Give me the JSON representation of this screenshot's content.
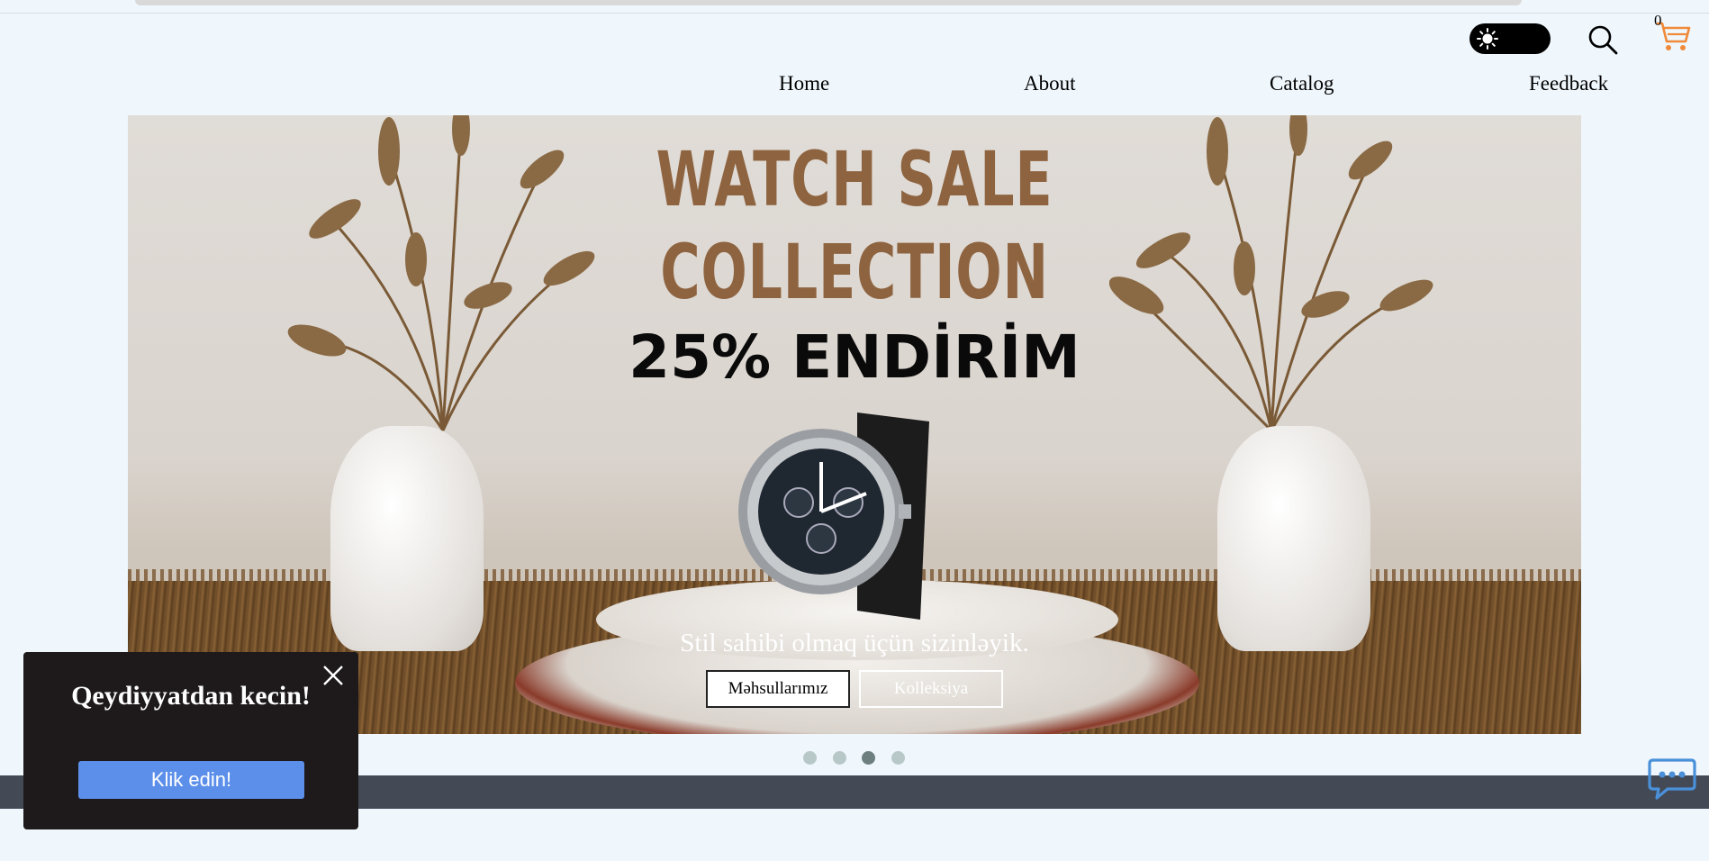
{
  "header": {
    "theme_toggle_icon": "sun-icon",
    "search_icon": "search-icon",
    "cart_icon": "cart-icon",
    "cart_count": "0",
    "cart_color": "#f08a3a"
  },
  "nav": {
    "items": [
      {
        "label": "Home"
      },
      {
        "label": "About"
      },
      {
        "label": "Catalog"
      },
      {
        "label": "Feedback"
      }
    ]
  },
  "hero": {
    "title_line1": "WATCH SALE",
    "title_line2": "COLLECTION",
    "discount": "25% ENDİRİM",
    "tagline": "Stil sahibi olmaq üçün sizinləyik.",
    "primary_button": "Məhsullarımız",
    "secondary_button": "Kolleksiya",
    "title_color": "#8e6440"
  },
  "slider": {
    "dot_count": 4,
    "active_index": 2
  },
  "popup": {
    "title": "Qeydiyyatdan kecin!",
    "button_label": "Klik edin!",
    "close_icon": "close-icon",
    "button_color": "#5c8fea"
  },
  "chat": {
    "icon": "chat-bubble-icon",
    "color": "#4a90d9"
  }
}
